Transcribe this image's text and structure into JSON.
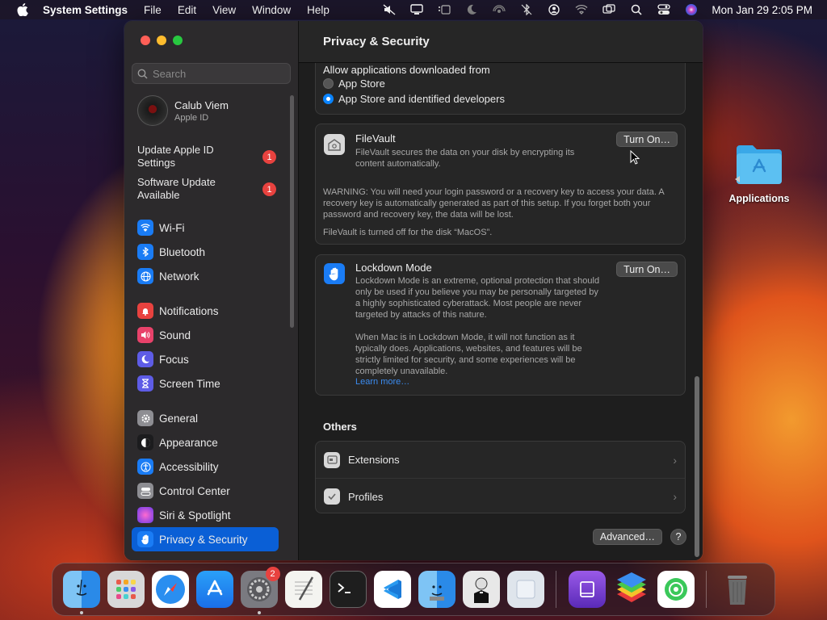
{
  "menubar": {
    "app_name": "System Settings",
    "menus": [
      "File",
      "Edit",
      "View",
      "Window",
      "Help"
    ],
    "clock": "Mon Jan 29  2:05 PM",
    "status_icons": [
      "mute-icon",
      "display-icon",
      "stage-manager-icon",
      "focus-moon-icon",
      "airdrop-icon",
      "bluetooth-off-icon",
      "user-icon",
      "wifi-icon",
      "screen-mirror-icon",
      "search-icon",
      "control-center-icon",
      "siri-icon"
    ]
  },
  "sidebar": {
    "search_placeholder": "Search",
    "account": {
      "name": "Calub Viem",
      "sub": "Apple ID"
    },
    "notices": [
      {
        "label": "Update Apple ID Settings",
        "badge": "1"
      },
      {
        "label": "Software Update Available",
        "badge": "1"
      }
    ],
    "group1": [
      {
        "label": "Wi-Fi",
        "icon": "wifi-icon",
        "color": "#1a7cf5"
      },
      {
        "label": "Bluetooth",
        "icon": "bluetooth-icon",
        "color": "#1a7cf5"
      },
      {
        "label": "Network",
        "icon": "globe-icon",
        "color": "#1a7cf5"
      }
    ],
    "group2": [
      {
        "label": "Notifications",
        "icon": "bell-icon",
        "color": "#e8423f"
      },
      {
        "label": "Sound",
        "icon": "speaker-icon",
        "color": "#e8426a"
      },
      {
        "label": "Focus",
        "icon": "moon-icon",
        "color": "#5e5ce6"
      },
      {
        "label": "Screen Time",
        "icon": "hourglass-icon",
        "color": "#5e5ce6"
      }
    ],
    "group3": [
      {
        "label": "General",
        "icon": "gear-icon",
        "color": "#8e8e93"
      },
      {
        "label": "Appearance",
        "icon": "appearance-icon",
        "color": "#1c1c1e"
      },
      {
        "label": "Accessibility",
        "icon": "accessibility-icon",
        "color": "#1a7cf5"
      },
      {
        "label": "Control Center",
        "icon": "control-center-icon",
        "color": "#8e8e93"
      },
      {
        "label": "Siri & Spotlight",
        "icon": "siri-icon",
        "color": "#b03ac8"
      },
      {
        "label": "Privacy & Security",
        "icon": "hand-icon",
        "color": "#1a7cf5"
      }
    ]
  },
  "content": {
    "title": "Privacy & Security",
    "allow": {
      "label": "Allow applications downloaded from",
      "options": [
        "App Store",
        "App Store and identified developers"
      ],
      "selected": "App Store and identified developers"
    },
    "filevault": {
      "title": "FileVault",
      "desc": "FileVault secures the data on your disk by encrypting its content automatically.",
      "button": "Turn On…",
      "warning": "WARNING: You will need your login password or a recovery key to access your data. A recovery key is automatically generated as part of this setup. If you forget both your password and recovery key, the data will be lost.",
      "status": "FileVault is turned off for the disk “MacOS”."
    },
    "lockdown": {
      "title": "Lockdown Mode",
      "desc": "Lockdown Mode is an extreme, optional protection that should only be used if you believe you may be personally targeted by a highly sophisticated cyberattack. Most people are never targeted by attacks of this nature.",
      "desc2": "When Mac is in Lockdown Mode, it will not function as it typically does. Applications, websites, and features will be strictly limited for security, and some experiences will be completely unavailable.",
      "link": "Learn more…",
      "button": "Turn On…"
    },
    "others_title": "Others",
    "others": [
      {
        "label": "Extensions",
        "icon": "extensions-icon"
      },
      {
        "label": "Profiles",
        "icon": "profiles-icon"
      }
    ],
    "advanced_button": "Advanced…",
    "help_button": "?"
  },
  "desktop": {
    "folder_label": "Applications"
  },
  "dock": {
    "apps": [
      {
        "name": "Finder",
        "icon": "finder-icon",
        "running": true
      },
      {
        "name": "Launchpad",
        "icon": "launchpad-icon"
      },
      {
        "name": "Safari",
        "icon": "safari-icon"
      },
      {
        "name": "App Store",
        "icon": "app-store-icon"
      },
      {
        "name": "System Settings",
        "icon": "settings-icon",
        "badge": "2",
        "running": true
      },
      {
        "name": "TextEdit",
        "icon": "textedit-icon"
      },
      {
        "name": "Terminal",
        "icon": "terminal-icon"
      },
      {
        "name": "Visual Studio Code",
        "icon": "vscode-icon"
      },
      {
        "name": "Migration Assistant",
        "icon": "migration-icon"
      },
      {
        "name": "Bartender",
        "icon": "bartender-icon"
      },
      {
        "name": "Preview",
        "icon": "preview-icon"
      },
      {
        "name": "Podcasts",
        "icon": "podcasts-icon"
      },
      {
        "name": "BlueStacks",
        "icon": "bluestacks-icon"
      },
      {
        "name": "Find My",
        "icon": "findmy-icon"
      },
      {
        "name": "Trash",
        "icon": "trash-icon"
      }
    ]
  }
}
